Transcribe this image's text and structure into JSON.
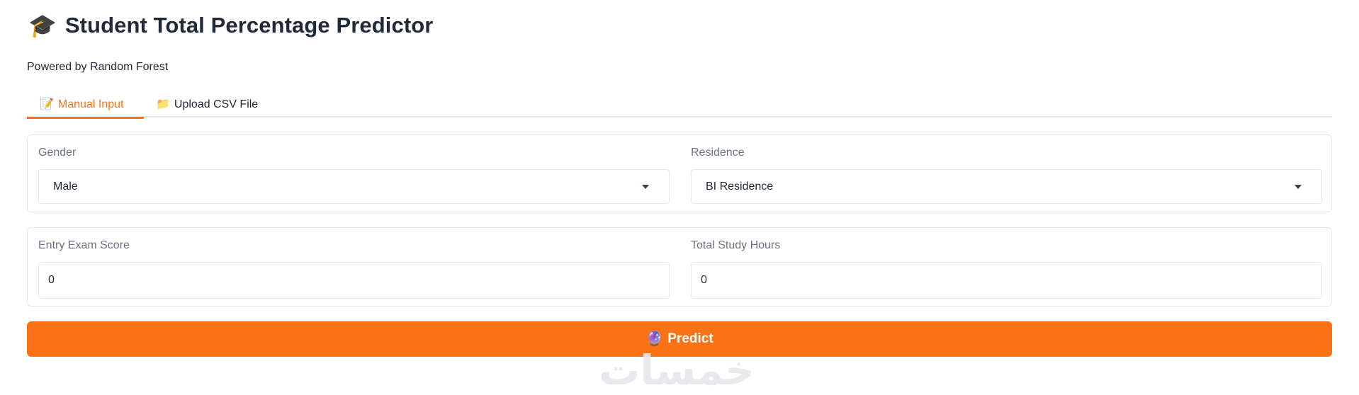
{
  "header": {
    "icon": "graduation-cap-icon",
    "title": "Student Total Percentage Predictor",
    "subtitle": "Powered by Random Forest"
  },
  "tabs": [
    {
      "icon": "memo-icon",
      "glyph": "📝",
      "label": "Manual Input",
      "active": true
    },
    {
      "icon": "folder-icon",
      "glyph": "📁",
      "label": "Upload CSV File",
      "active": false
    }
  ],
  "form": {
    "gender": {
      "label": "Gender",
      "value": "Male"
    },
    "residence": {
      "label": "Residence",
      "value": "BI Residence"
    },
    "entry_exam_score": {
      "label": "Entry Exam Score",
      "value": "0"
    },
    "total_study_hours": {
      "label": "Total Study Hours",
      "value": "0"
    }
  },
  "predict_button": {
    "icon": "crystal-ball-icon",
    "label": "Predict"
  },
  "watermark": "خمسات",
  "colors": {
    "accent": "#f97316",
    "border": "#e5e7eb",
    "label": "#6b7280"
  }
}
